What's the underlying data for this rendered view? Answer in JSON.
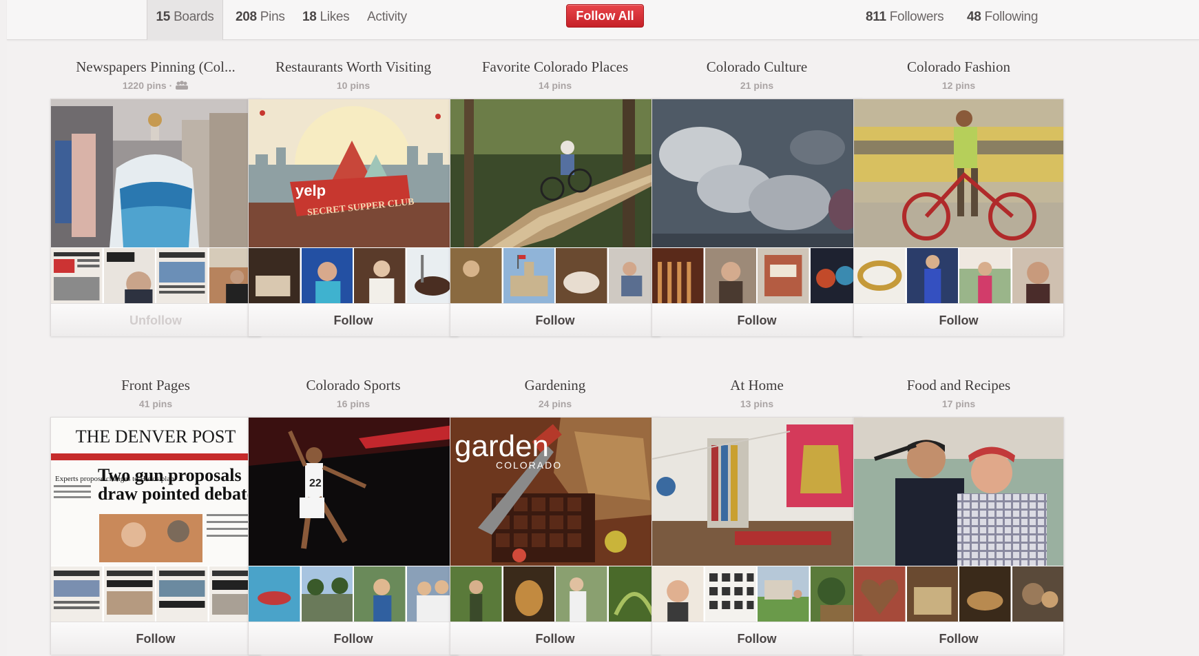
{
  "nav": {
    "boards": {
      "count": "15",
      "label": "Boards"
    },
    "pins": {
      "count": "208",
      "label": "Pins"
    },
    "likes": {
      "count": "18",
      "label": "Likes"
    },
    "activity": "Activity",
    "follow_all": "Follow All",
    "followers": {
      "count": "811",
      "label": "Followers"
    },
    "following": {
      "count": "48",
      "label": "Following"
    }
  },
  "boards": [
    {
      "title": "Newspapers Pinning (Col...",
      "count": "1220 pins · ",
      "button": "Unfollow"
    },
    {
      "title": "Restaurants Worth Visiting",
      "count": "10 pins",
      "button": "Follow"
    },
    {
      "title": "Favorite Colorado Places",
      "count": "14 pins",
      "button": "Follow"
    },
    {
      "title": "Colorado Culture",
      "count": "21 pins",
      "button": "Follow"
    },
    {
      "title": "Colorado Fashion",
      "count": "12 pins",
      "button": "Follow"
    },
    {
      "title": "Front Pages",
      "count": "41 pins",
      "button": "Follow"
    },
    {
      "title": "Colorado Sports",
      "count": "16 pins",
      "button": "Follow"
    },
    {
      "title": "Gardening",
      "count": "24 pins",
      "button": "Follow"
    },
    {
      "title": "At Home",
      "count": "13 pins",
      "button": "Follow"
    },
    {
      "title": "Food and Recipes",
      "count": "17 pins",
      "button": "Follow"
    }
  ],
  "cover_text": {
    "yelp": "yelp",
    "supper_club": "SECRET SUPPER CLUB",
    "denver_post": "THE DENVER POST",
    "headline": "Two gun proposals draw pointed debate",
    "side_story": "Experts propose changes to Hick's plan",
    "jersey": "22",
    "garden": "garden",
    "garden_sub": "COLORADO"
  }
}
